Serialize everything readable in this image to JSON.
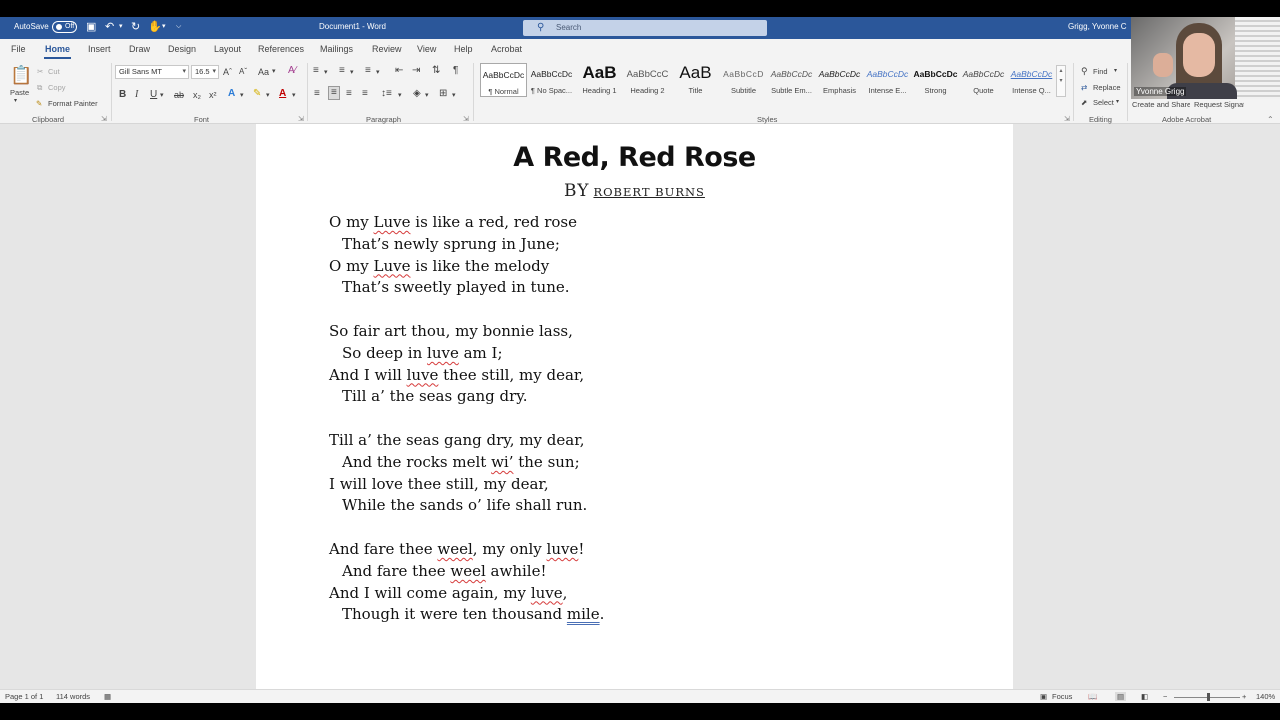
{
  "titlebar": {
    "autosave_label": "AutoSave",
    "autosave_state": "Off",
    "doc_title": "Document1 - Word",
    "search_placeholder": "Search",
    "user_name": "Grigg, Yvonne C",
    "color": "#2b579a"
  },
  "tabs": [
    "File",
    "Home",
    "Insert",
    "Draw",
    "Design",
    "Layout",
    "References",
    "Mailings",
    "Review",
    "View",
    "Help",
    "Acrobat"
  ],
  "ribbon": {
    "clipboard": {
      "paste": "Paste",
      "cut": "Cut",
      "copy": "Copy",
      "format_painter": "Format Painter",
      "label": "Clipboard"
    },
    "font": {
      "family": "Gill Sans MT",
      "size": "16.5",
      "case": "Aa",
      "bold": "B",
      "italic": "I",
      "underline": "U",
      "strikethrough": "ab",
      "subscript": "x₂",
      "superscript": "x²",
      "label": "Font"
    },
    "paragraph": {
      "pilcrow": "¶",
      "label": "Paragraph"
    },
    "styles": {
      "label": "Styles",
      "items": [
        {
          "preview": "AaBbCcDc",
          "name": "¶ Normal"
        },
        {
          "preview": "AaBbCcDc",
          "name": "¶ No Spac..."
        },
        {
          "preview": "AaB",
          "name": "Heading 1"
        },
        {
          "preview": "AaBbCcC",
          "name": "Heading 2"
        },
        {
          "preview": "AaB",
          "name": "Title"
        },
        {
          "preview": "AaBbCcD",
          "name": "Subtitle"
        },
        {
          "preview": "AaBbCcDc",
          "name": "Subtle Em..."
        },
        {
          "preview": "AaBbCcDc",
          "name": "Emphasis"
        },
        {
          "preview": "AaBbCcDc",
          "name": "Intense E..."
        },
        {
          "preview": "AaBbCcDc",
          "name": "Strong"
        },
        {
          "preview": "AaBbCcDc",
          "name": "Quote"
        },
        {
          "preview": "AaBbCcDc",
          "name": "Intense Q..."
        }
      ]
    },
    "editing": {
      "find": "Find",
      "replace": "Replace",
      "select": "Select",
      "label": "Editing"
    },
    "acrobat": {
      "create_pdf": "Create and Share Adobe PDF",
      "signatures": "Request Signatures",
      "label": "Adobe Acrobat"
    }
  },
  "document": {
    "title": "A Red, Red Rose",
    "by": "BY",
    "author": "ROBERT BURNS",
    "stanzas": [
      [
        {
          "text": "O my Luve is like a red, red rose",
          "indent": false
        },
        {
          "text": "That’s newly sprung in June;",
          "indent": true
        },
        {
          "text": "O my Luve is like the melody",
          "indent": false
        },
        {
          "text": "That’s sweetly played in tune.",
          "indent": true
        }
      ],
      [
        {
          "text": "So fair art thou, my bonnie lass,",
          "indent": false
        },
        {
          "text": "So deep in luve am I;",
          "indent": true
        },
        {
          "text": "And I will luve thee still, my dear,",
          "indent": false
        },
        {
          "text": "Till a’ the seas gang dry.",
          "indent": true
        }
      ],
      [
        {
          "text": "Till a’ the seas gang dry, my dear,",
          "indent": false
        },
        {
          "text": "And the rocks melt wi’ the sun;",
          "indent": true
        },
        {
          "text": "I will love thee still, my dear,",
          "indent": false
        },
        {
          "text": "While the sands o’ life shall run.",
          "indent": true
        }
      ],
      [
        {
          "text": "And fare thee weel, my only luve!",
          "indent": false
        },
        {
          "text": "And fare thee weel awhile!",
          "indent": true
        },
        {
          "text": "And I will come again, my luve,",
          "indent": false
        },
        {
          "text": "Though it were ten thousand mile.",
          "indent": true
        }
      ]
    ],
    "spelling_flagged": [
      "Luve",
      "luve",
      "wi’",
      "weel"
    ],
    "grammar_flagged": [
      "mile"
    ]
  },
  "statusbar": {
    "page": "Page 1 of 1",
    "words": "114 words",
    "focus": "Focus",
    "zoom": "140%"
  },
  "webcam": {
    "name": "Yvonne Grigg"
  }
}
